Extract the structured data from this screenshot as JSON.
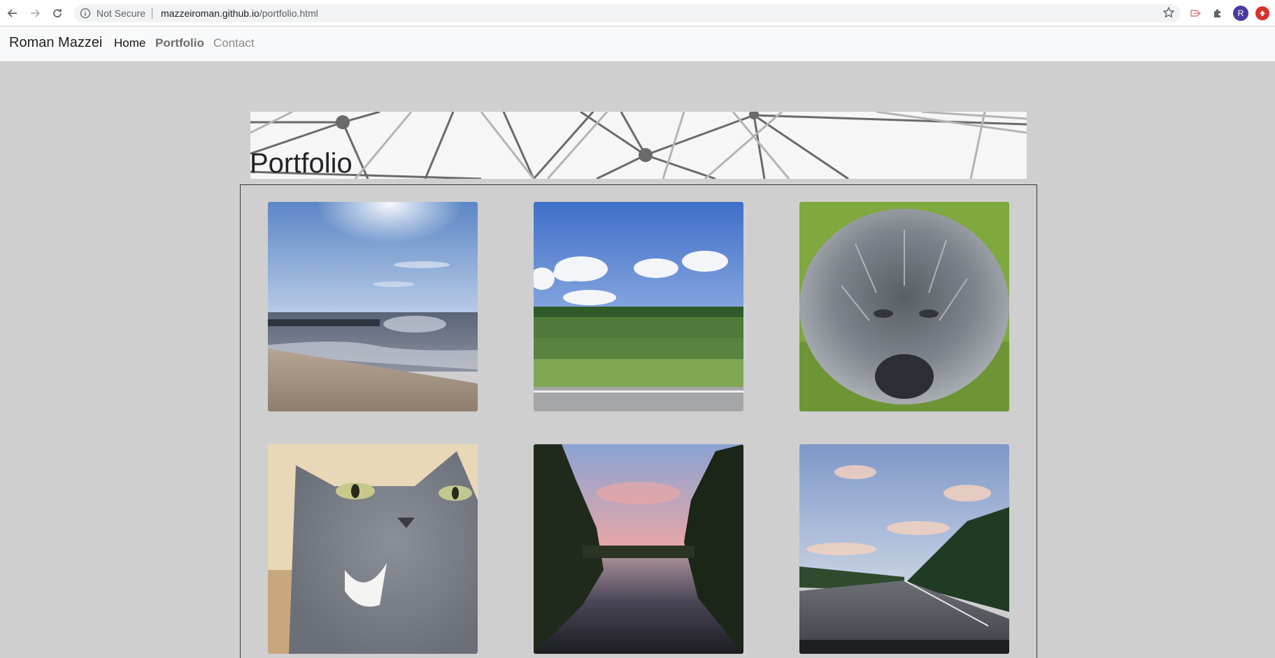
{
  "browser": {
    "security_label": "Not Secure",
    "url_host": "mazzeiroman.github.io",
    "url_path": "/portfolio.html",
    "avatar_letter": "R",
    "icons": [
      "back-arrow-icon",
      "forward-arrow-icon",
      "reload-icon",
      "info-icon",
      "star-icon",
      "extension-icon",
      "puzzle-icon",
      "update-icon"
    ]
  },
  "navbar": {
    "brand": "Roman Mazzei",
    "links": [
      {
        "label": "Home"
      },
      {
        "label": "Portfolio"
      },
      {
        "label": "Contact"
      }
    ]
  },
  "banner": {
    "title": "Portfolio"
  },
  "gallery": {
    "photos": [
      {
        "subject": "beach"
      },
      {
        "subject": "field"
      },
      {
        "subject": "dog"
      },
      {
        "subject": "cat"
      },
      {
        "subject": "river-sunset"
      },
      {
        "subject": "highway-sky"
      }
    ]
  },
  "colors": {
    "page_background": "#cfcfcf",
    "navbar_background": "#f8f9fa",
    "avatar": "#4a3aa0"
  }
}
